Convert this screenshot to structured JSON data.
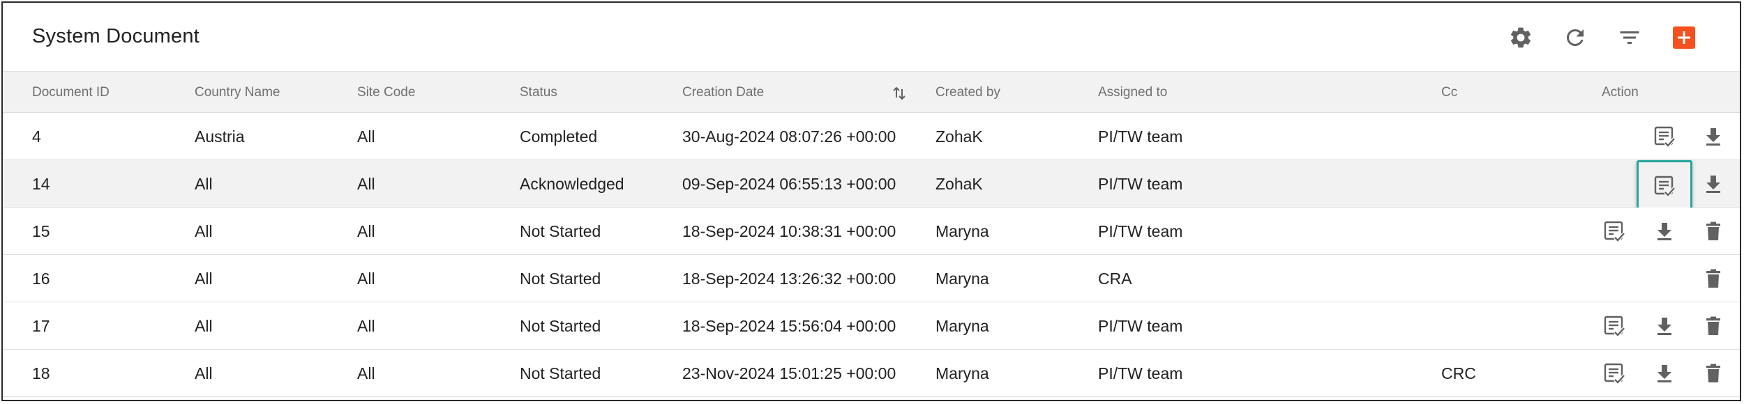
{
  "header": {
    "title": "System Document"
  },
  "toolbar_icons": [
    "gear-icon",
    "refresh-icon",
    "filter-icon",
    "add-icon"
  ],
  "colors": {
    "accent": "#f4511e",
    "focus_ring": "#26a69a",
    "icon": "#616161"
  },
  "columns": {
    "document_id": "Document ID",
    "country_name": "Country Name",
    "site_code": "Site Code",
    "status": "Status",
    "creation_date": "Creation Date",
    "created_by": "Created by",
    "assigned_to": "Assigned to",
    "cc": "Cc",
    "action": "Action"
  },
  "rows": [
    {
      "id": "4",
      "country": "Austria",
      "site": "All",
      "status": "Completed",
      "date": "30-Aug-2024 08:07:26 +00:00",
      "created_by": "ZohaK",
      "assigned_to": "PI/TW team",
      "cc": ""
    },
    {
      "id": "14",
      "country": "All",
      "site": "All",
      "status": "Acknowledged",
      "date": "09-Sep-2024 06:55:13 +00:00",
      "created_by": "ZohaK",
      "assigned_to": "PI/TW team",
      "cc": ""
    },
    {
      "id": "15",
      "country": "All",
      "site": "All",
      "status": "Not Started",
      "date": "18-Sep-2024 10:38:31 +00:00",
      "created_by": "Maryna",
      "assigned_to": "PI/TW team",
      "cc": ""
    },
    {
      "id": "16",
      "country": "All",
      "site": "All",
      "status": "Not Started",
      "date": "18-Sep-2024 13:26:32 +00:00",
      "created_by": "Maryna",
      "assigned_to": "CRA",
      "cc": ""
    },
    {
      "id": "17",
      "country": "All",
      "site": "All",
      "status": "Not Started",
      "date": "18-Sep-2024 15:56:04 +00:00",
      "created_by": "Maryna",
      "assigned_to": "PI/TW team",
      "cc": ""
    },
    {
      "id": "18",
      "country": "All",
      "site": "All",
      "status": "Not Started",
      "date": "23-Nov-2024 15:01:25 +00:00",
      "created_by": "Maryna",
      "assigned_to": "PI/TW team",
      "cc": "CRC"
    }
  ]
}
